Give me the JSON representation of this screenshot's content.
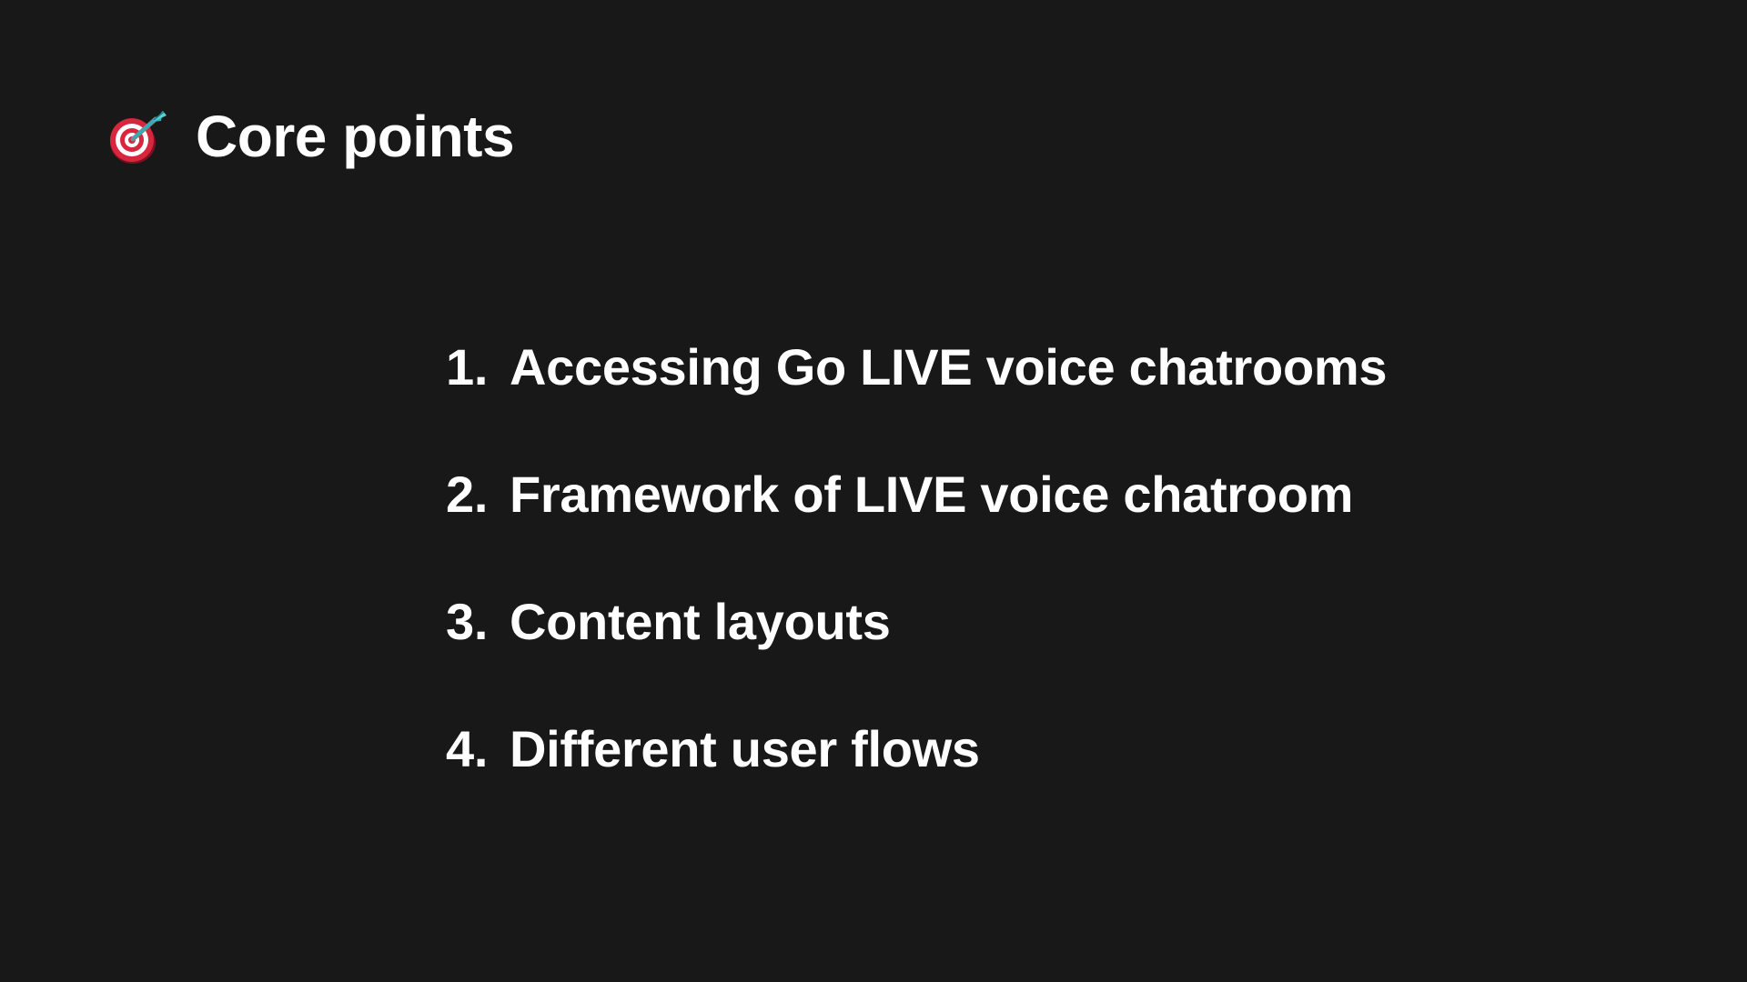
{
  "header": {
    "icon": "target-dart-icon",
    "title": "Core points"
  },
  "points": [
    {
      "number": "1.",
      "label": "Accessing Go LIVE voice chatrooms"
    },
    {
      "number": "2.",
      "label": "Framework of LIVE voice chatroom"
    },
    {
      "number": "3.",
      "label": "Content layouts"
    },
    {
      "number": "4.",
      "label": "Different user flows"
    }
  ],
  "colors": {
    "background": "#181818",
    "text": "#ffffff",
    "icon_red": "#d7263d",
    "icon_teal": "#2eaeb6"
  }
}
